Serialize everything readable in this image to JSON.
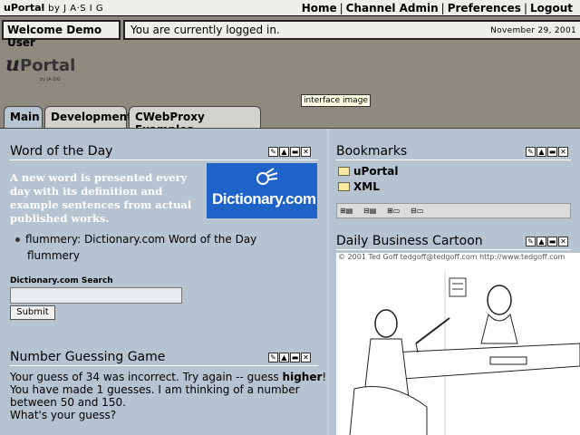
{
  "header": {
    "brand": "uPortal",
    "brand_by": "by J A·S I G",
    "nav": [
      "Home",
      "Channel Admin",
      "Preferences",
      "Logout"
    ],
    "welcome": "Welcome Demo User",
    "status": "You are currently logged in.",
    "date": "November 29, 2001",
    "logo_text_u": "u",
    "logo_text_portal": "Portal",
    "logo_sub": "by JA-SIG",
    "tooltip": "interface image"
  },
  "tabs": [
    {
      "label": "Main",
      "active": true
    },
    {
      "label": "Development",
      "active": false
    },
    {
      "label": "CWebProxy Examples",
      "active": false
    }
  ],
  "word_of_day": {
    "title": "Word of the Day",
    "description": "A new word is presented every day with its definition and example sentences from actual published works.",
    "logo_text": "Dictionary.com",
    "item_link": "flummery: Dictionary.com Word of the Day",
    "item_word": "flummery",
    "search_label": "Dictionary.com Search",
    "search_value": "",
    "submit_label": "Submit"
  },
  "number_game": {
    "title": "Number Guessing Game",
    "line1_pre": "Your guess of 34 was incorrect. Try again -- guess ",
    "line1_bold": "higher",
    "line1_post": "!",
    "line2": "You have made 1 guesses. I am thinking of a number between 50 and 150.",
    "line3": "What's your guess?"
  },
  "bookmarks": {
    "title": "Bookmarks",
    "items": [
      "uPortal",
      "XML"
    ]
  },
  "cartoon": {
    "title": "Daily Business Cartoon",
    "caption": "© 2001 Ted Goff tedgoff@tedgoff.com http://www.tedgoff.com"
  },
  "colors": {
    "content_bg": "#b6c3d1",
    "page_bg": "#8f8a80",
    "dict_blue": "#1f63c9"
  }
}
